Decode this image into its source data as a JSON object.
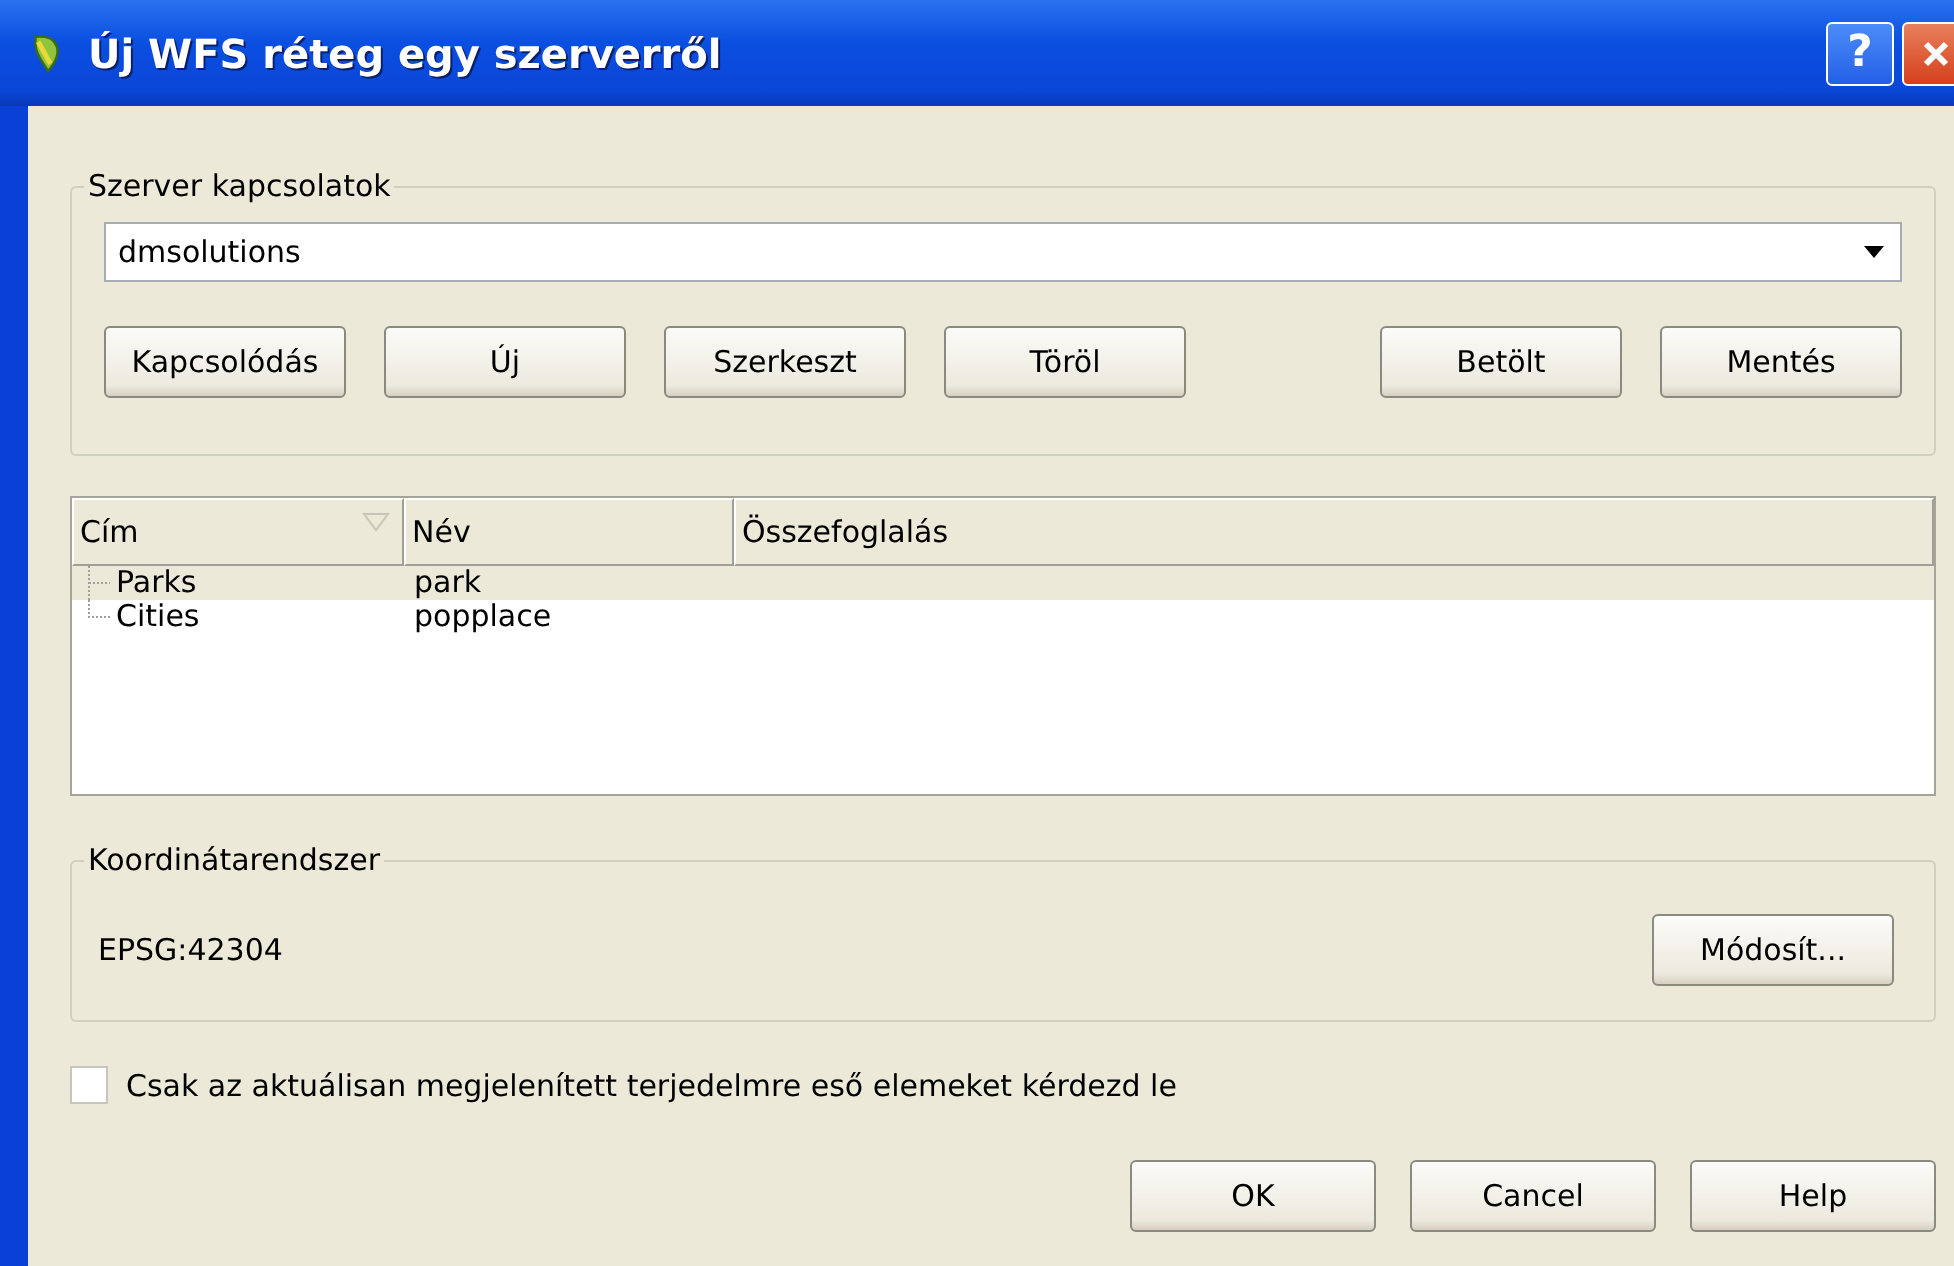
{
  "window": {
    "title": "Új WFS réteg egy szerverről",
    "help_button": "?"
  },
  "server_connections": {
    "label": "Szerver kapcsolatok",
    "selected_server": "dmsolutions",
    "left_buttons": [
      "Kapcsolódás",
      "Új",
      "Szerkeszt",
      "Töröl"
    ],
    "right_buttons": [
      "Betölt",
      "Mentés"
    ]
  },
  "table": {
    "columns": [
      "Cím",
      "Név",
      "Összefoglalás"
    ],
    "rows": [
      {
        "cells": [
          "Parks",
          "park"
        ],
        "selected": true
      },
      {
        "cells": [
          "Cities",
          "popplace"
        ],
        "selected": false
      }
    ]
  },
  "crs": {
    "label": "Koordinátarendszer",
    "value": "EPSG:42304",
    "button": "Módosít..."
  },
  "only_extent": {
    "label": "Csak az aktuálisan megjelenített terjedelmre eső elemeket kérdezd le",
    "checked": false
  },
  "buttons": [
    "OK",
    "Cancel",
    "Help"
  ]
}
